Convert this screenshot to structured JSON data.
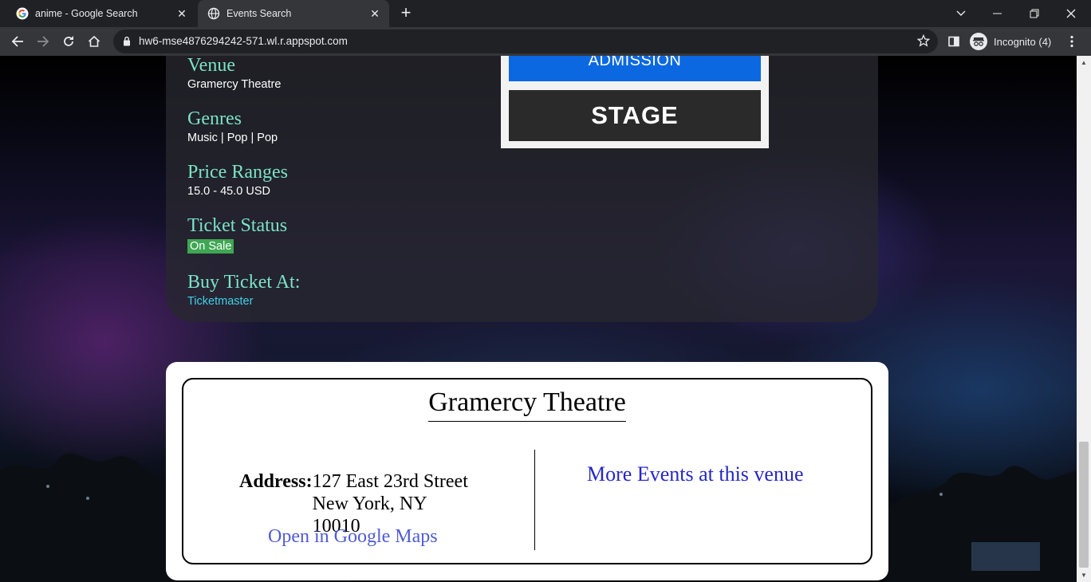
{
  "browser": {
    "tabs": [
      {
        "title": "anime - Google Search",
        "favicon": "google-g-icon",
        "active": false
      },
      {
        "title": "Events Search",
        "favicon": "globe-icon",
        "active": true
      }
    ],
    "url": "hw6-mse4876294242-571.wl.r.appspot.com",
    "incognito_label": "Incognito (4)"
  },
  "details": {
    "venue_heading": "Venue",
    "venue_value": "Gramercy Theatre",
    "genres_heading": "Genres",
    "genres_value": "Music | Pop | Pop",
    "price_heading": "Price Ranges",
    "price_value": "15.0 - 45.0 USD",
    "status_heading": "Ticket Status",
    "status_value": "On Sale",
    "status_color": "#3fa653",
    "buy_heading": "Buy Ticket At:",
    "buy_link": "Ticketmaster"
  },
  "seatmap": {
    "ga_label": "ADMISSION",
    "stage_label": "STAGE"
  },
  "venue_card": {
    "title": "Gramercy Theatre",
    "address_label": "Address:",
    "address_line1": "127 East 23rd Street",
    "address_line2": "New York, NY",
    "address_line3": "10010",
    "maps_link": "Open in Google Maps",
    "more_events_link": "More Events at this venue"
  },
  "colors": {
    "heading_accent": "#7be3c6",
    "ticket_link": "#3fd1e6",
    "maps_link": "#4f5bd5",
    "more_events_link": "#2626c9"
  }
}
